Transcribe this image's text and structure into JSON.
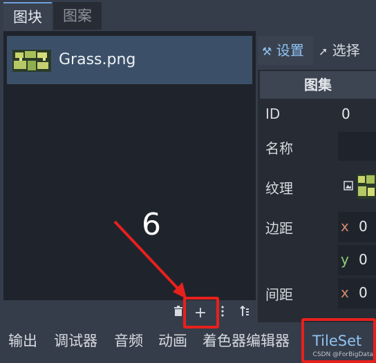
{
  "top_tabs": {
    "tiles": "图块",
    "patterns": "图案"
  },
  "source_list": {
    "items": [
      {
        "label": "Grass.png"
      }
    ]
  },
  "annotation_number": "6",
  "toolbar": {
    "delete_icon": "trash-icon",
    "add_icon": "plus-icon",
    "menu_icon": "kebab-menu-icon",
    "sort_icon": "sort-icon"
  },
  "right_tabs": {
    "setup": "设置",
    "select": "选择"
  },
  "inspector": {
    "section_title": "图集",
    "id_label": "ID",
    "id_value": "0",
    "name_label": "名称",
    "texture_label": "纹理",
    "margins_label": "边距",
    "margins_x": "0",
    "margins_y": "0",
    "separation_label": "间距",
    "separation_x": "0",
    "axis_x": "x",
    "axis_y": "y"
  },
  "bottom_dock": [
    "输出",
    "调试器",
    "音频",
    "动画",
    "着色器编辑器",
    "TileSet"
  ],
  "watermark": "CSDN @ForBigData",
  "colors": {
    "highlight_red": "#e8201c",
    "accent_blue": "#8fc3f3",
    "selected_row": "#3b5068"
  }
}
